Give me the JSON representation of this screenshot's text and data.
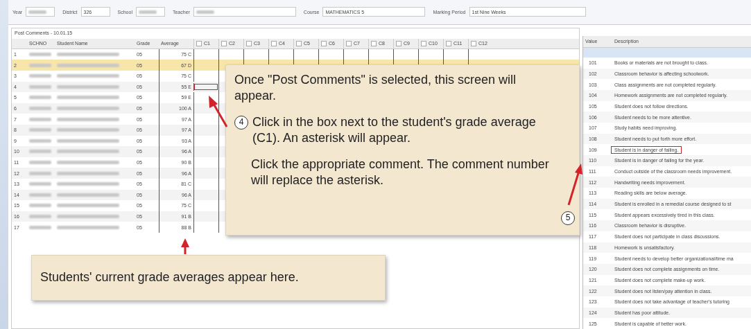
{
  "filters": [
    {
      "label": "Year",
      "redacted": true
    },
    {
      "label": "District",
      "value": "326",
      "redacted": false
    },
    {
      "label": "School",
      "redacted": true
    },
    {
      "label": "Teacher",
      "redacted": true
    },
    {
      "label": "Course",
      "value": "MATHEMATICS 5",
      "redacted": false
    },
    {
      "label": "Marking Period",
      "value": "1st Nine Weeks",
      "redacted": false
    }
  ],
  "panel_title": "Post Comments - 10.01.15",
  "table": {
    "columns": [
      {
        "label": "SCHNO"
      },
      {
        "label": "Student Name"
      },
      {
        "label": "Grade"
      },
      {
        "label": "Average"
      }
    ],
    "comment_columns": [
      {
        "label": "C1",
        "checked": false
      },
      {
        "label": "C2",
        "checked": false
      },
      {
        "label": "C3",
        "checked": false
      },
      {
        "label": "C4",
        "checked": false
      },
      {
        "label": "C5",
        "checked": false
      },
      {
        "label": "C6",
        "checked": false
      },
      {
        "label": "C7",
        "checked": false
      },
      {
        "label": "C8",
        "checked": false
      },
      {
        "label": "C9",
        "checked": false
      },
      {
        "label": "C10",
        "checked": false
      },
      {
        "label": "C11",
        "checked": false
      },
      {
        "label": "C12",
        "checked": false
      }
    ],
    "rows": [
      {
        "number": "1",
        "grade": "05",
        "average": "75 C",
        "selected": false,
        "marked": false
      },
      {
        "number": "2",
        "grade": "05",
        "average": "67 D",
        "selected": true,
        "marked": false
      },
      {
        "number": "3",
        "grade": "05",
        "average": "75 C",
        "selected": false,
        "marked": false
      },
      {
        "number": "4",
        "grade": "05",
        "average": "55 E",
        "selected": false,
        "marked": true
      },
      {
        "number": "5",
        "grade": "05",
        "average": "59 E",
        "selected": false,
        "marked": false
      },
      {
        "number": "6",
        "grade": "05",
        "average": "100 A",
        "selected": false,
        "marked": false
      },
      {
        "number": "7",
        "grade": "05",
        "average": "97 A",
        "selected": false,
        "marked": false
      },
      {
        "number": "8",
        "grade": "05",
        "average": "97 A",
        "selected": false,
        "marked": false
      },
      {
        "number": "9",
        "grade": "05",
        "average": "93 A",
        "selected": false,
        "marked": false
      },
      {
        "number": "10",
        "grade": "05",
        "average": "96 A",
        "selected": false,
        "marked": false
      },
      {
        "number": "11",
        "grade": "05",
        "average": "90 B",
        "selected": false,
        "marked": false
      },
      {
        "number": "12",
        "grade": "05",
        "average": "96 A",
        "selected": false,
        "marked": false
      },
      {
        "number": "13",
        "grade": "05",
        "average": "81 C",
        "selected": false,
        "marked": false
      },
      {
        "number": "14",
        "grade": "05",
        "average": "96 A",
        "selected": false,
        "marked": false
      },
      {
        "number": "15",
        "grade": "05",
        "average": "75 C",
        "selected": false,
        "marked": false
      },
      {
        "number": "16",
        "grade": "05",
        "average": "91 B",
        "selected": false,
        "marked": false
      },
      {
        "number": "17",
        "grade": "05",
        "average": "88 B",
        "selected": false,
        "marked": false
      }
    ]
  },
  "comments": {
    "columns": [
      {
        "label": "Value"
      },
      {
        "label": "Description"
      }
    ],
    "blank_row_selected": true,
    "rows": [
      {
        "value": "101",
        "description": "Books or materials are not brought to class.",
        "marked": false
      },
      {
        "value": "102",
        "description": "Classroom behavior is affecting schoolwork.",
        "marked": false
      },
      {
        "value": "103",
        "description": "Class assignments are not completed regularly.",
        "marked": false
      },
      {
        "value": "104",
        "description": "Homework assignments are not completed regularly.",
        "marked": false
      },
      {
        "value": "105",
        "description": "Student does not follow directions.",
        "marked": false
      },
      {
        "value": "106",
        "description": "Student needs to be more attentive.",
        "marked": false
      },
      {
        "value": "107",
        "description": "Study habits need improving.",
        "marked": false
      },
      {
        "value": "108",
        "description": "Student needs to put forth more effort.",
        "marked": false
      },
      {
        "value": "109",
        "description": "Student is in danger of failing.",
        "marked": true
      },
      {
        "value": "110",
        "description": "Student is in danger of failing for the year.",
        "marked": false
      },
      {
        "value": "111",
        "description": "Conduct outside of the classroom needs improvement.",
        "marked": false
      },
      {
        "value": "112",
        "description": "Handwriting needs improvement.",
        "marked": false
      },
      {
        "value": "113",
        "description": "Reading skills are below average.",
        "marked": false
      },
      {
        "value": "114",
        "description": "Student is enrolled in a remedial course designed to st",
        "marked": false
      },
      {
        "value": "115",
        "description": "Student appears excessively tired in this class.",
        "marked": false
      },
      {
        "value": "116",
        "description": "Classroom behavior is disruptive.",
        "marked": false
      },
      {
        "value": "117",
        "description": "Student does not participate in class discussions.",
        "marked": false
      },
      {
        "value": "118",
        "description": "Homework is unsatisfactory.",
        "marked": false
      },
      {
        "value": "119",
        "description": "Student needs to develop better organizational/time ma",
        "marked": false
      },
      {
        "value": "120",
        "description": "Student does not complete assignments on time.",
        "marked": false
      },
      {
        "value": "121",
        "description": "Student does not complete make-up work.",
        "marked": false
      },
      {
        "value": "122",
        "description": "Student does not listen/pay attention in class.",
        "marked": false
      },
      {
        "value": "123",
        "description": "Student does not take advantage of teacher's tutoring",
        "marked": false
      },
      {
        "value": "124",
        "description": "Student has poor attitude.",
        "marked": false
      },
      {
        "value": "125",
        "description": "Student is capable of better work.",
        "marked": false
      }
    ]
  },
  "callouts": [
    {
      "kind": "steps",
      "intro": "Once \"Post Comments\" is selected, this screen will appear.",
      "step_number": "4",
      "step_text": "Click in the box next to the student's grade average (C1).  An asterisk will appear.",
      "note": "Click the appropriate comment.  The comment number will replace the asterisk.",
      "badge": "5"
    },
    {
      "kind": "note",
      "text": "Students' current grade averages appear here."
    }
  ]
}
